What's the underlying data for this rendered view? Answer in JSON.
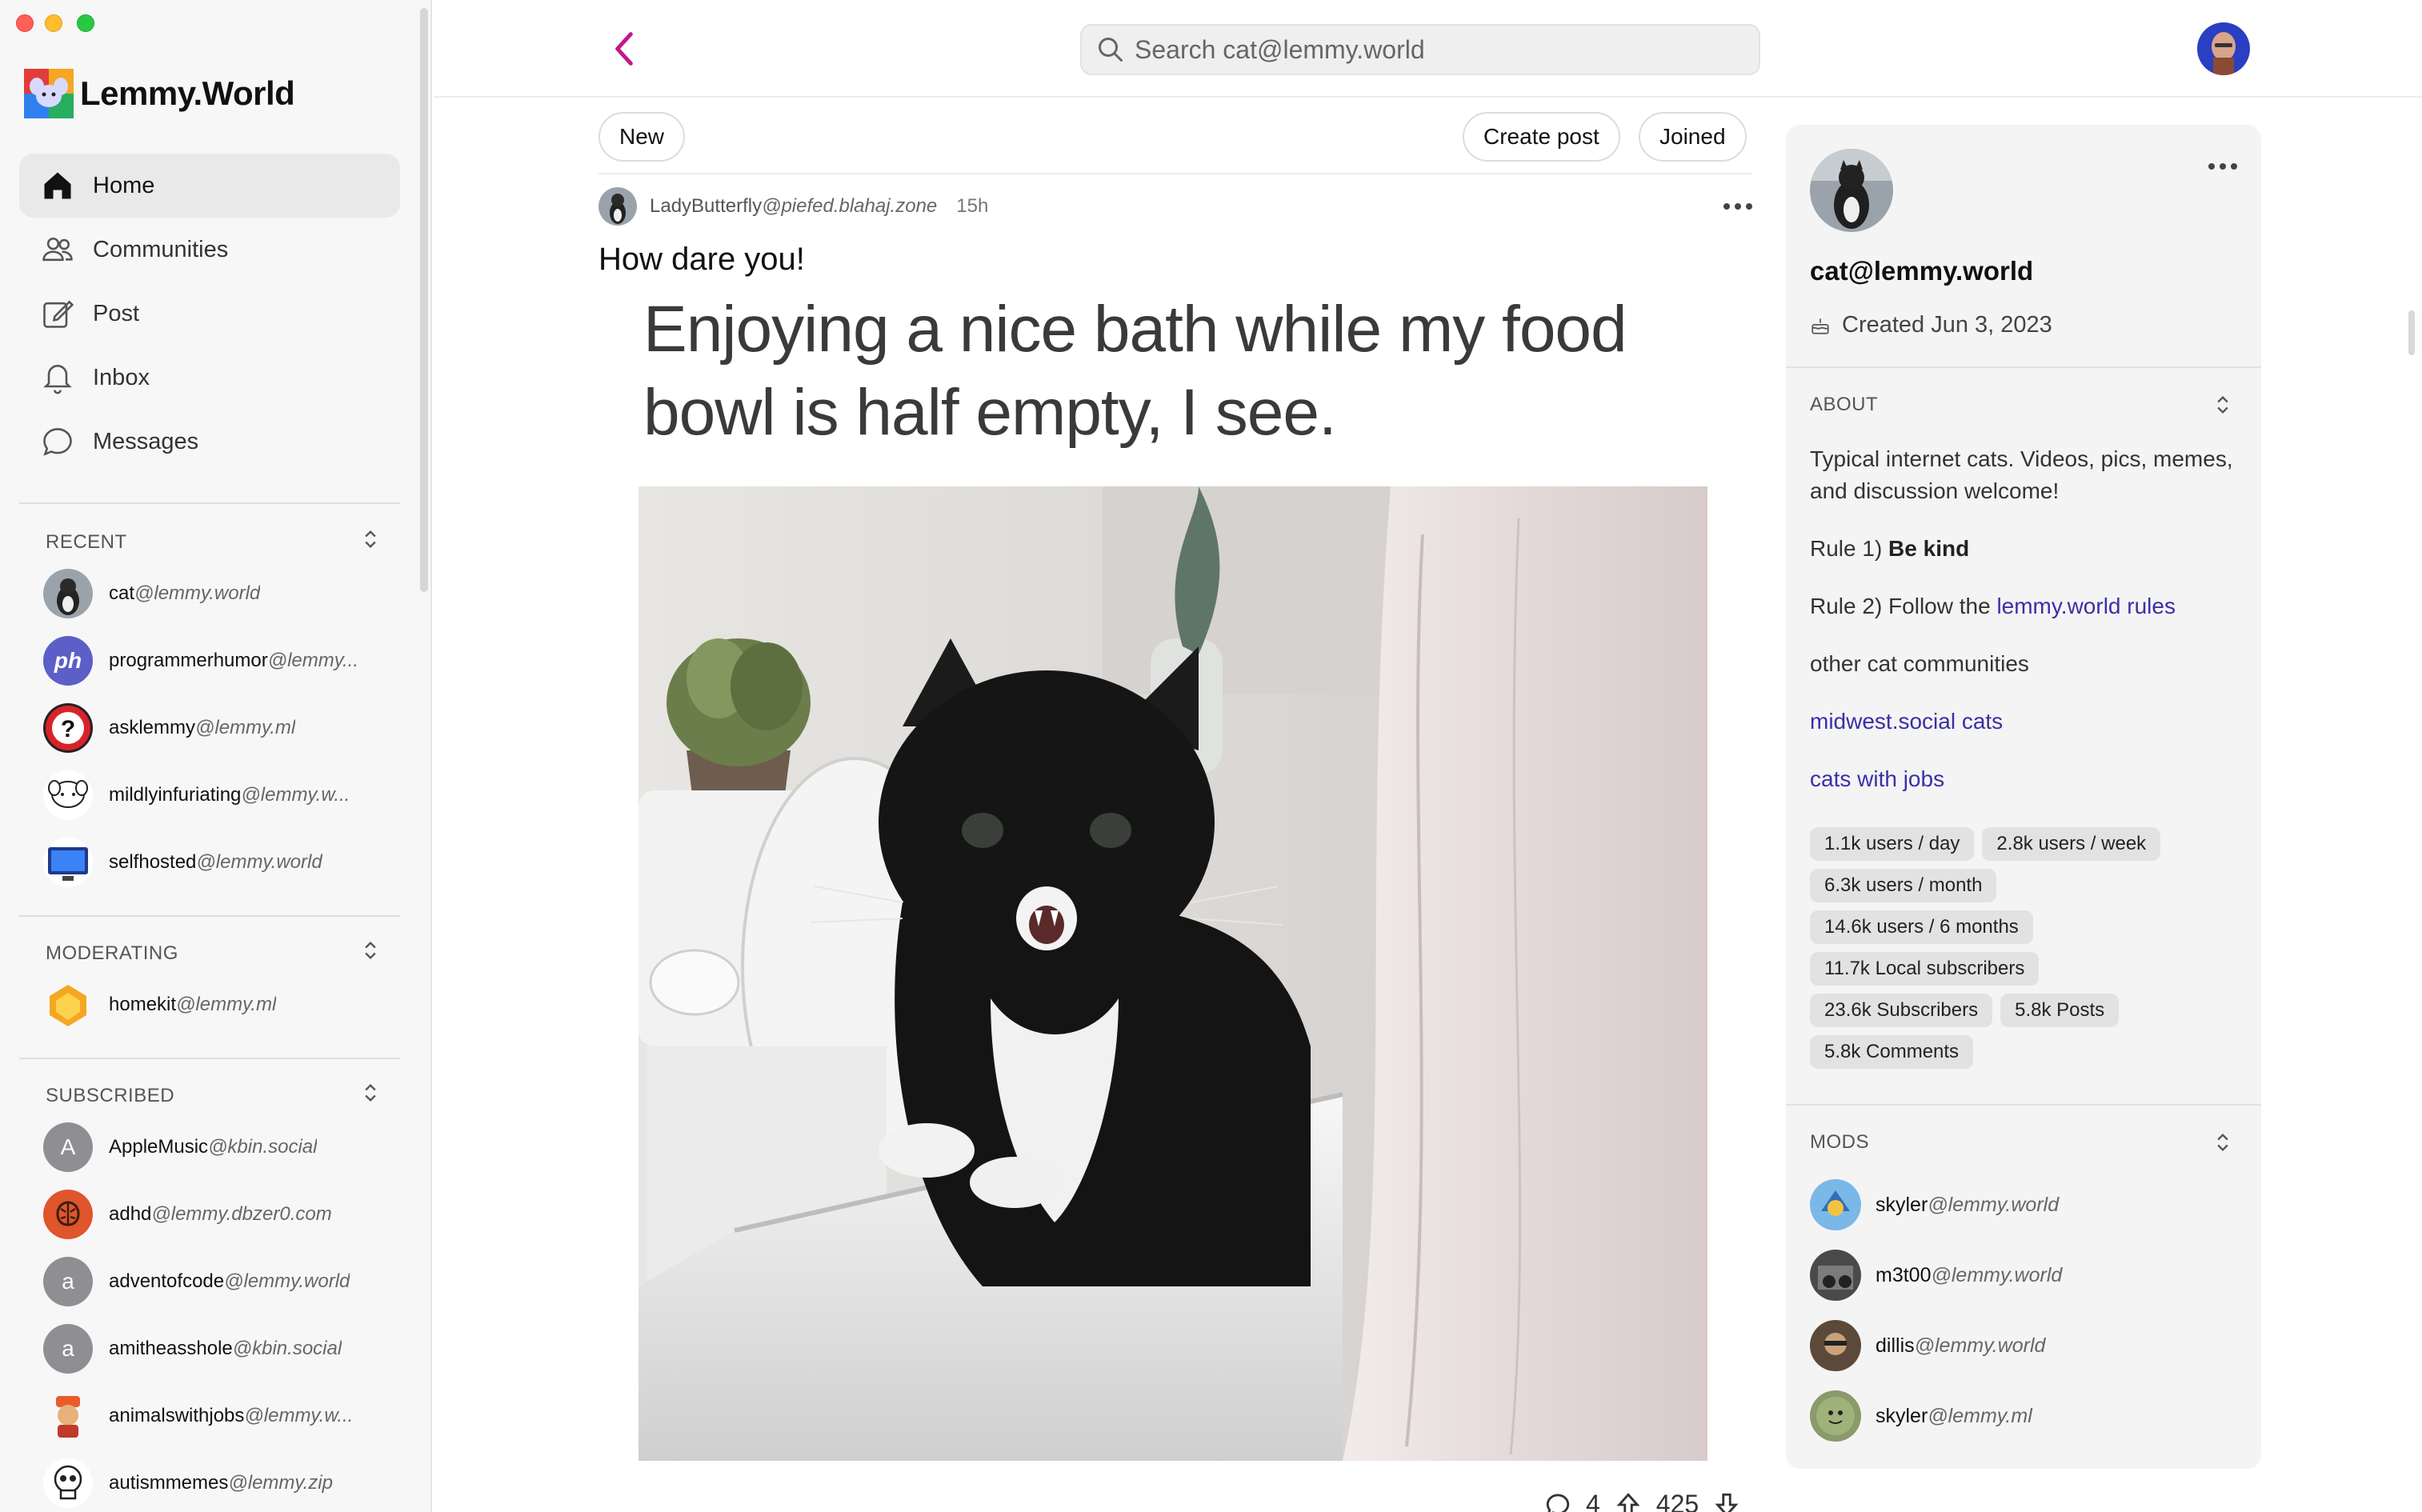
{
  "app": {
    "brand": "Lemmy.World"
  },
  "nav": {
    "items": [
      {
        "label": "Home",
        "icon": "home-icon",
        "active": true
      },
      {
        "label": "Communities",
        "icon": "people-icon"
      },
      {
        "label": "Post",
        "icon": "compose-icon"
      },
      {
        "label": "Inbox",
        "icon": "bell-icon"
      },
      {
        "label": "Messages",
        "icon": "chat-bubble-icon"
      }
    ]
  },
  "sections": {
    "recent": {
      "title": "RECENT",
      "items": [
        {
          "name": "cat",
          "instance": "@lemmy.world"
        },
        {
          "name": "programmerhumor",
          "instance": "@lemmy..."
        },
        {
          "name": "asklemmy",
          "instance": "@lemmy.ml"
        },
        {
          "name": "mildlyinfuriating",
          "instance": "@lemmy.w..."
        },
        {
          "name": "selfhosted",
          "instance": "@lemmy.world"
        }
      ]
    },
    "moderating": {
      "title": "MODERATING",
      "items": [
        {
          "name": "homekit",
          "instance": "@lemmy.ml"
        }
      ]
    },
    "subscribed": {
      "title": "SUBSCRIBED",
      "items": [
        {
          "name": "AppleMusic",
          "instance": "@kbin.social",
          "initial": "A"
        },
        {
          "name": "adhd",
          "instance": "@lemmy.dbzer0.com"
        },
        {
          "name": "adventofcode",
          "instance": "@lemmy.world",
          "initial": "a"
        },
        {
          "name": "amitheasshole",
          "instance": "@kbin.social",
          "initial": "a"
        },
        {
          "name": "animalswithjobs",
          "instance": "@lemmy.w..."
        },
        {
          "name": "autismmemes",
          "instance": "@lemmy.zip"
        }
      ]
    }
  },
  "search": {
    "placeholder": "Search cat@lemmy.world"
  },
  "feed": {
    "sort_label": "New",
    "create_label": "Create post",
    "joined_label": "Joined"
  },
  "post": {
    "author": "LadyButterfly",
    "author_instance": "@piefed.blahaj.zone",
    "age": "15h",
    "title": "How dare you!",
    "image_caption": "Enjoying a nice bath while my food bowl is half empty, I see.",
    "comments": "4",
    "score": "425"
  },
  "community": {
    "handle": "cat@lemmy.world",
    "created": "Created Jun 3, 2023",
    "about_title": "ABOUT",
    "description": "Typical internet cats. Videos, pics, memes, and discussion welcome!",
    "rule1_prefix": "Rule 1)",
    "rule1_bold": "Be kind",
    "rule2_prefix": "Rule 2) Follow the",
    "rule2_link": "lemmy.world rules",
    "other_label": "other cat communities",
    "link1": "midwest.social cats",
    "link2": "cats with jobs",
    "stats": [
      "1.1k users / day",
      "2.8k users / week",
      "6.3k users / month",
      "14.6k users / 6 months",
      "11.7k Local subscribers",
      "23.6k Subscribers",
      "5.8k Posts",
      "5.8k Comments"
    ],
    "mods_title": "MODS",
    "mods": [
      {
        "name": "skyler",
        "instance": "@lemmy.world"
      },
      {
        "name": "m3t00",
        "instance": "@lemmy.world"
      },
      {
        "name": "dillis",
        "instance": "@lemmy.world"
      },
      {
        "name": "skyler",
        "instance": "@lemmy.ml"
      }
    ]
  },
  "colors": {
    "accent": "#c2188b",
    "link": "#3a2fa8",
    "sidebar_bg": "#f7f7f7",
    "panel_bg": "#f4f4f4"
  }
}
